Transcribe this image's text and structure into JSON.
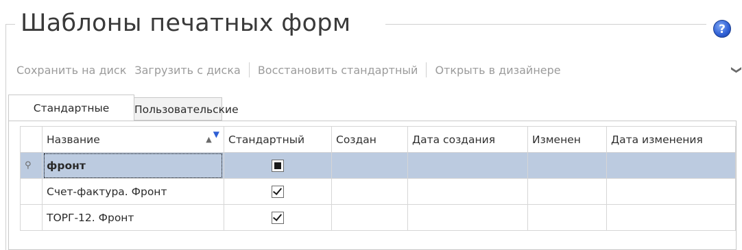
{
  "page": {
    "title": "Шаблоны печатных форм",
    "help_label": "?"
  },
  "toolbar": {
    "save_to_disk": "Сохранить на диск",
    "load_from_disk": "Загрузить с диска",
    "restore_default": "Восстановить стандартный",
    "open_in_designer": "Открыть в дизайнере",
    "more": "❯"
  },
  "tabs": [
    {
      "label": "Стандартные",
      "active": true
    },
    {
      "label": "Пользовательские",
      "active": false
    }
  ],
  "grid": {
    "columns": [
      "Название",
      "Стандартный",
      "Создан",
      "Дата создания",
      "Изменен",
      "Дата изменения"
    ],
    "filter_row_indicator": "⚲",
    "sort": "ascending",
    "rows": [
      {
        "name": "фронт",
        "standard": "indeterminate",
        "created_by": "",
        "created_date": "",
        "modified_by": "",
        "modified_date": "",
        "filter_row": true
      },
      {
        "name": "Счет-фактура. Фронт",
        "standard": "checked",
        "created_by": "",
        "created_date": "",
        "modified_by": "",
        "modified_date": ""
      },
      {
        "name": "ТОРГ-12. Фронт",
        "standard": "checked",
        "created_by": "",
        "created_date": "",
        "modified_by": "",
        "modified_date": ""
      }
    ]
  },
  "colors": {
    "selection": "#bccbe0",
    "toolbar_text": "#9b9b9b",
    "help_icon": "#2f5fd4"
  }
}
